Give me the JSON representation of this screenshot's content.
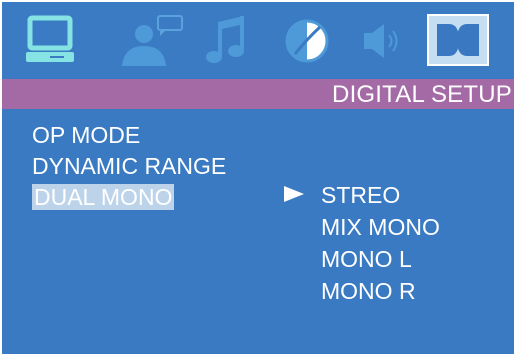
{
  "title": "DIGITAL SETUP",
  "icons": [
    {
      "name": "monitor-icon",
      "color": "#7fdcdf"
    },
    {
      "name": "user-chat-icon",
      "color": "#4e9ad8"
    },
    {
      "name": "music-note-icon",
      "color": "#4e9ad8"
    },
    {
      "name": "color-disc-icon",
      "color": "#4e9ad8"
    },
    {
      "name": "speaker-icon",
      "color": "#4e9ad8"
    },
    {
      "name": "dolby-icon",
      "color": "#3a79c2",
      "selected": true
    }
  ],
  "menu": {
    "items": [
      {
        "label": "OP MODE"
      },
      {
        "label": "DYNAMIC RANGE"
      },
      {
        "label": "DUAL MONO",
        "active": true
      }
    ]
  },
  "options": {
    "selected_index": 0,
    "items": [
      {
        "label": "STREO"
      },
      {
        "label": "MIX MONO"
      },
      {
        "label": "MONO L"
      },
      {
        "label": "MONO R"
      }
    ]
  }
}
